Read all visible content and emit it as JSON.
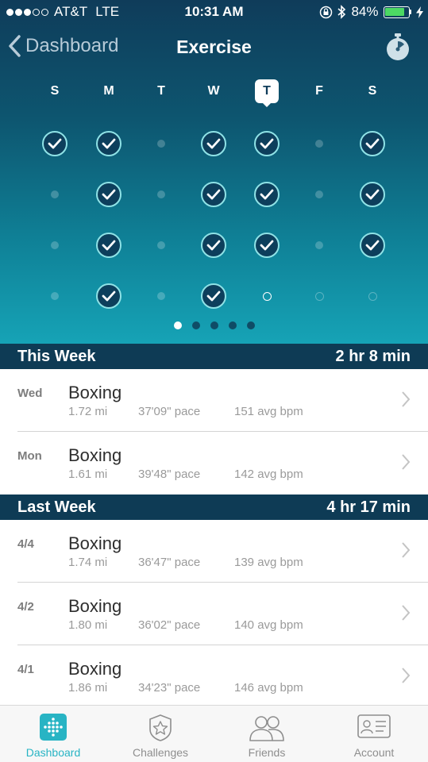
{
  "status_bar": {
    "carrier": "AT&T",
    "network": "LTE",
    "time": "10:31 AM",
    "battery": "84%",
    "battery_level": 0.84,
    "signal_bars_filled": 3,
    "signal_bars_total": 5
  },
  "nav": {
    "back_label": "Dashboard",
    "title": "Exercise"
  },
  "week": {
    "days": [
      "S",
      "M",
      "T",
      "W",
      "T",
      "F",
      "S"
    ],
    "today_index": 4,
    "grid": [
      [
        "check",
        "check",
        "dot",
        "check",
        "check",
        "dot",
        "check"
      ],
      [
        "dot",
        "check",
        "dot",
        "check",
        "check",
        "dot",
        "check"
      ],
      [
        "dot",
        "check",
        "dot",
        "check",
        "check",
        "dot",
        "check"
      ],
      [
        "dot",
        "check",
        "dot",
        "check",
        "ring",
        "ring-faint",
        "ring-faint"
      ]
    ],
    "pages": 5,
    "active_page": 0
  },
  "this_week": {
    "label": "This Week",
    "total": "2 hr 8 min",
    "items": [
      {
        "day": "Wed",
        "title": "Boxing",
        "distance": "1.72 mi",
        "pace": "37'09\" pace",
        "bpm": "151 avg bpm"
      },
      {
        "day": "Mon",
        "title": "Boxing",
        "distance": "1.61 mi",
        "pace": "39'48\" pace",
        "bpm": "142 avg bpm"
      }
    ]
  },
  "last_week": {
    "label": "Last Week",
    "total": "4 hr 17 min",
    "items": [
      {
        "day": "4/4",
        "title": "Boxing",
        "distance": "1.74 mi",
        "pace": "36'47\" pace",
        "bpm": "139 avg bpm"
      },
      {
        "day": "4/2",
        "title": "Boxing",
        "distance": "1.80 mi",
        "pace": "36'02\" pace",
        "bpm": "140 avg bpm"
      },
      {
        "day": "4/1",
        "title": "Boxing",
        "distance": "1.86 mi",
        "pace": "34'23\" pace",
        "bpm": "146 avg bpm"
      }
    ]
  },
  "tabbar": {
    "tabs": [
      {
        "label": "Dashboard",
        "icon": "dashboard-dots-icon",
        "active": true
      },
      {
        "label": "Challenges",
        "icon": "star-badge-icon",
        "active": false
      },
      {
        "label": "Friends",
        "icon": "friends-icon",
        "active": false
      },
      {
        "label": "Account",
        "icon": "id-card-icon",
        "active": false
      }
    ]
  },
  "colors": {
    "header_dark": "#0f3c5a",
    "header_light": "#16a3b6",
    "section_header": "#0e3b55",
    "check_ring": "#8fe2e6",
    "active_tab": "#28b4c4",
    "battery": "#4cd964"
  }
}
